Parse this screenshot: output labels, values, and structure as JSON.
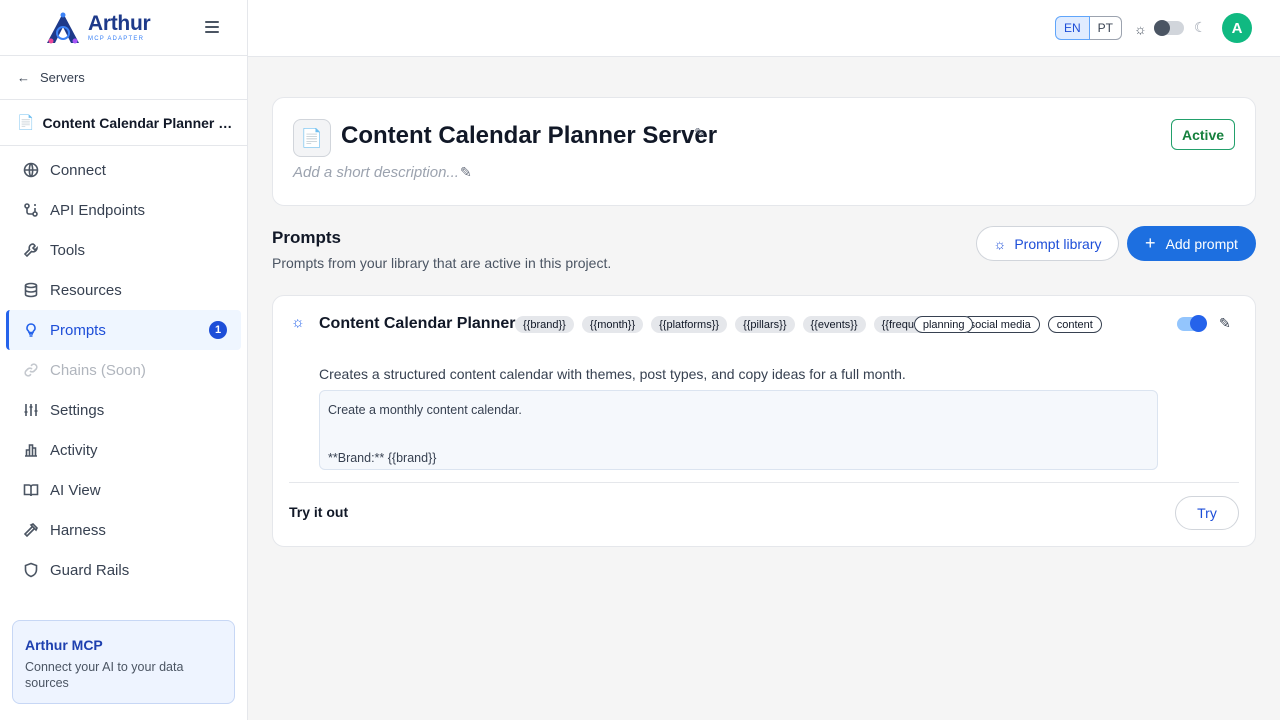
{
  "brand": {
    "name": "Arthur",
    "subtitle": "MCP ADAPTER"
  },
  "sidebar": {
    "back_label": "Servers",
    "server_name": "Content Calendar Planner Server",
    "items": [
      {
        "label": "Connect",
        "icon": "globe-icon"
      },
      {
        "label": "API Endpoints",
        "icon": "api-icon"
      },
      {
        "label": "Tools",
        "icon": "wrench-icon"
      },
      {
        "label": "Resources",
        "icon": "database-icon"
      },
      {
        "label": "Prompts",
        "icon": "bulb-icon",
        "badge": "1",
        "active": true
      },
      {
        "label": "Chains (Soon)",
        "icon": "link-icon",
        "disabled": true
      },
      {
        "label": "Settings",
        "icon": "sliders-icon"
      },
      {
        "label": "Activity",
        "icon": "chart-icon"
      },
      {
        "label": "AI View",
        "icon": "book-icon"
      },
      {
        "label": "Harness",
        "icon": "hammer-icon"
      },
      {
        "label": "Guard Rails",
        "icon": "shield-icon"
      }
    ],
    "promo": {
      "title": "Arthur MCP",
      "text": "Connect your AI to your data sources"
    }
  },
  "topbar": {
    "lang_en": "EN",
    "lang_pt": "PT",
    "avatar_initial": "A"
  },
  "server": {
    "title": "Content Calendar Planner Server",
    "description_placeholder": "Add a short description...",
    "status": "Active"
  },
  "prompts_section": {
    "title": "Prompts",
    "subtitle": "Prompts from your library that are active in this project.",
    "library_button": "Prompt library",
    "add_button": "Add prompt"
  },
  "prompt": {
    "title": "Content Calendar Planner",
    "variables": [
      "{{brand}}",
      "{{month}}",
      "{{platforms}}",
      "{{pillars}}",
      "{{events}}",
      "{{frequency}}"
    ],
    "tags": [
      "social media",
      "content",
      "planning"
    ],
    "description": "Creates a structured content calendar with themes, post types, and copy ideas for a full month.",
    "template_line1": "Create a monthly content calendar.",
    "template_line2": "**Brand:** {{brand}}",
    "enabled": true,
    "try_label": "Try it out",
    "try_button": "Try"
  },
  "colors": {
    "accent": "#1d6fe0",
    "active_status": "#15803d",
    "avatar": "#10b981"
  }
}
